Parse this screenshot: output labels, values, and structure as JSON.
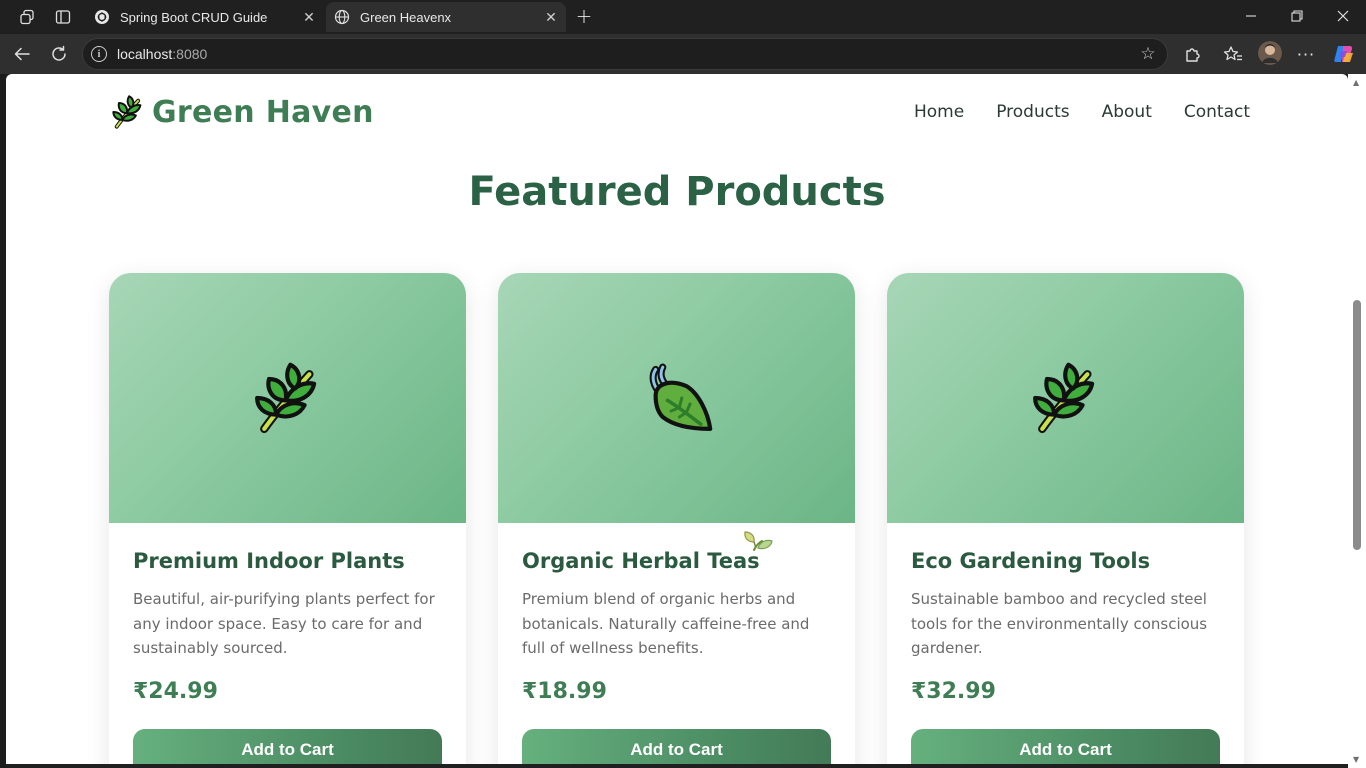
{
  "browser": {
    "tabs": [
      {
        "title": "Spring Boot CRUD Guide",
        "active": false,
        "icon": "openai-icon"
      },
      {
        "title": "Green Heavenx",
        "active": true,
        "icon": "globe-icon"
      }
    ],
    "url_host": "localhost",
    "url_port": ":8080"
  },
  "site": {
    "brand": "Green Haven",
    "nav": [
      "Home",
      "Products",
      "About",
      "Contact"
    ],
    "section_title": "Featured Products",
    "accent": "#3f7d55"
  },
  "products": [
    {
      "title": "Premium Indoor Plants",
      "description": "Beautiful, air-purifying plants perfect for any indoor space. Easy to care for and sustainably sourced.",
      "price": "₹24.99",
      "button": "Add to Cart",
      "icon": "herb-icon"
    },
    {
      "title": "Organic Herbal Teas",
      "description": "Premium blend of organic herbs and botanicals. Naturally caffeine-free and full of wellness benefits.",
      "price": "₹18.99",
      "button": "Add to Cart",
      "icon": "leaf-wind-icon"
    },
    {
      "title": "Eco Gardening Tools",
      "description": "Sustainable bamboo and recycled steel tools for the environmentally conscious gardener.",
      "price": "₹32.99",
      "button": "Add to Cart",
      "icon": "herb-icon"
    }
  ]
}
